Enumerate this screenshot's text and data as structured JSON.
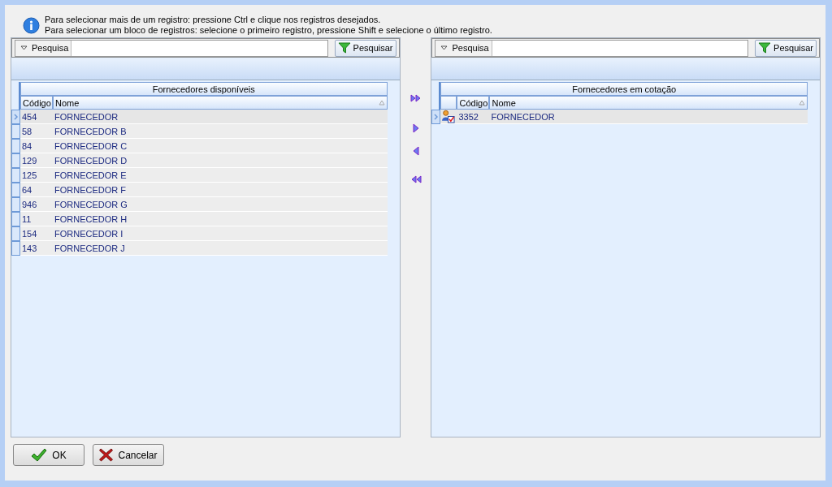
{
  "info": {
    "lines": [
      "Para selecionar mais de um registro: pressione Ctrl e clique nos registros desejados.",
      "Para selecionar um bloco de registros: selecione o primeiro registro, pressione Shift e selecione o último registro."
    ]
  },
  "panels": [
    {
      "kind": "available",
      "search": {
        "field_label": "Pesquisa",
        "button": "Pesquisar"
      },
      "title": "Fornecedores disponíveis",
      "columns": [
        "Código",
        "Nome"
      ],
      "rows": [
        {
          "code": "454",
          "name": "FORNECEDOR",
          "selected": true
        },
        {
          "code": "58",
          "name": "FORNECEDOR B",
          "selected": false
        },
        {
          "code": "84",
          "name": "FORNECEDOR C",
          "selected": false
        },
        {
          "code": "129",
          "name": "FORNECEDOR D",
          "selected": false
        },
        {
          "code": "125",
          "name": "FORNECEDOR E",
          "selected": false
        },
        {
          "code": "64",
          "name": "FORNECEDOR F",
          "selected": false
        },
        {
          "code": "946",
          "name": "FORNECEDOR G",
          "selected": false
        },
        {
          "code": "11",
          "name": "FORNECEDOR H",
          "selected": false
        },
        {
          "code": "154",
          "name": "FORNECEDOR I",
          "selected": false
        },
        {
          "code": "143",
          "name": "FORNECEDOR J",
          "selected": false
        }
      ]
    },
    {
      "kind": "quoted",
      "search": {
        "field_label": "Pesquisa",
        "button": "Pesquisar"
      },
      "title": "Fornecedores em cotação",
      "columns": [
        "Código",
        "Nome"
      ],
      "rows": [
        {
          "code": "3352",
          "name": "FORNECEDOR",
          "selected": true
        }
      ]
    }
  ],
  "transfer_buttons": [
    {
      "kind": "add_all"
    },
    {
      "kind": "add"
    },
    {
      "kind": "remove"
    },
    {
      "kind": "remove_all"
    }
  ],
  "buttons": [
    {
      "kind": "ok",
      "label": "OK"
    },
    {
      "kind": "cancel",
      "label": "Cancelar"
    }
  ]
}
